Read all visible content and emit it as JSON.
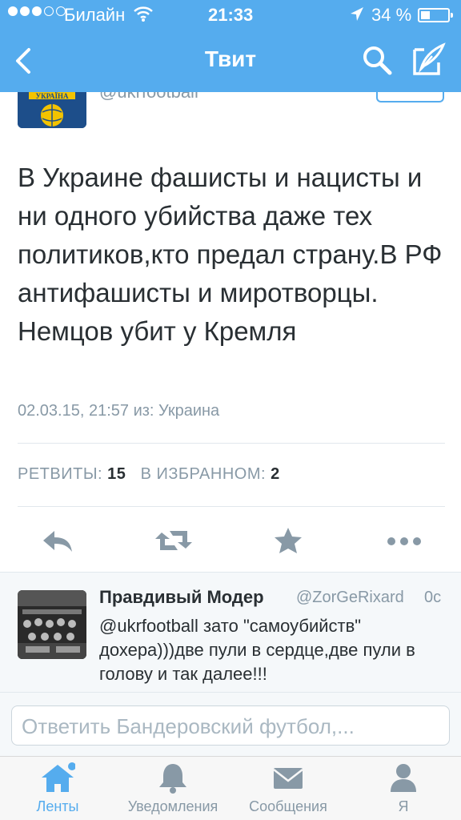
{
  "status_bar": {
    "carrier": "Билайн",
    "time": "21:33",
    "battery": "34 %"
  },
  "nav": {
    "title": "Твит"
  },
  "tweet": {
    "handle": "@ukrfootball",
    "avatar_text": "УКРАЇНА",
    "text": "В Украине фашисты и нацисты и ни одного убийства даже тех политиков,кто предал страну.В РФ антифашисты и миротворцы. Немцов убит у Кремля",
    "meta": "02.03.15, 21:57 из: Украина",
    "retweets_label": "РЕТВИТЫ:",
    "retweets_count": "15",
    "favorites_label": "В ИЗБРАННОМ:",
    "favorites_count": "2"
  },
  "reply": {
    "name": "Правдивый Модер",
    "handle": "@ZorGeRixard",
    "time": "0c",
    "text": "@ukrfootball зато \"самоубийств\" дохера)))две пули в сердце,две пули в голову и так далее!!!"
  },
  "compose": {
    "placeholder": "Ответить Бандеровский футбол,..."
  },
  "tabs": [
    {
      "label": "Ленты",
      "icon": "home-icon",
      "active": true
    },
    {
      "label": "Уведомления",
      "icon": "bell-icon",
      "active": false
    },
    {
      "label": "Сообщения",
      "icon": "envelope-icon",
      "active": false
    },
    {
      "label": "Я",
      "icon": "person-icon",
      "active": false
    }
  ],
  "colors": {
    "brand": "#55acee",
    "text": "#292f33",
    "muted": "#8899a6"
  }
}
